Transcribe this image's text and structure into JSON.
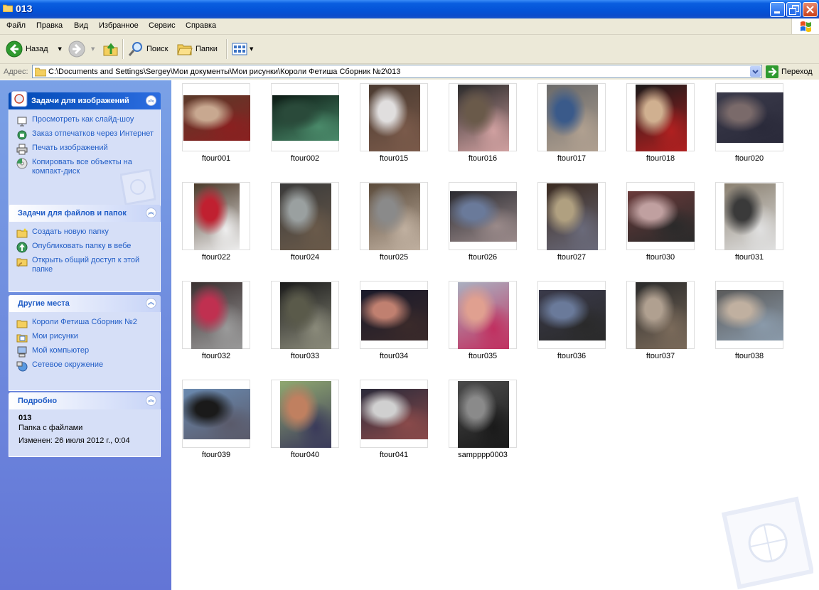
{
  "window": {
    "title": "013"
  },
  "menu": [
    "Файл",
    "Правка",
    "Вид",
    "Избранное",
    "Сервис",
    "Справка"
  ],
  "toolbar": {
    "back": "Назад",
    "search": "Поиск",
    "folders": "Папки"
  },
  "address": {
    "label": "Адрес:",
    "path": "C:\\Documents and Settings\\Sergey\\Мои документы\\Мои рисунки\\Короли Фетиша Сборник №2\\013",
    "go": "Переход"
  },
  "panels": {
    "image_tasks": {
      "title": "Задачи для изображений",
      "items": [
        "Просмотреть как слайд-шоу",
        "Заказ отпечатков через Интернет",
        "Печать изображений",
        "Копировать все объекты на компакт-диск"
      ]
    },
    "file_tasks": {
      "title": "Задачи для файлов и папок",
      "items": [
        "Создать новую папку",
        "Опубликовать папку в вебе",
        "Открыть общий доступ к этой папке"
      ]
    },
    "other_places": {
      "title": "Другие места",
      "items": [
        "Короли Фетиша Сборник №2",
        "Мои рисунки",
        "Мой компьютер",
        "Сетевое окружение"
      ]
    },
    "details": {
      "title": "Подробно",
      "name": "013",
      "type": "Папка с файлами",
      "modified": "Изменен: 26 июля 2012 г., 0:04"
    }
  },
  "files": [
    "ftour001",
    "ftour002",
    "ftour015",
    "ftour016",
    "ftour017",
    "ftour018",
    "ftour020",
    "ftour022",
    "ftour024",
    "ftour025",
    "ftour026",
    "ftour027",
    "ftour030",
    "ftour031",
    "ftour032",
    "ftour033",
    "ftour034",
    "ftour035",
    "ftour036",
    "ftour037",
    "ftour038",
    "ftour039",
    "ftour040",
    "ftour041",
    "sampppp0003"
  ]
}
